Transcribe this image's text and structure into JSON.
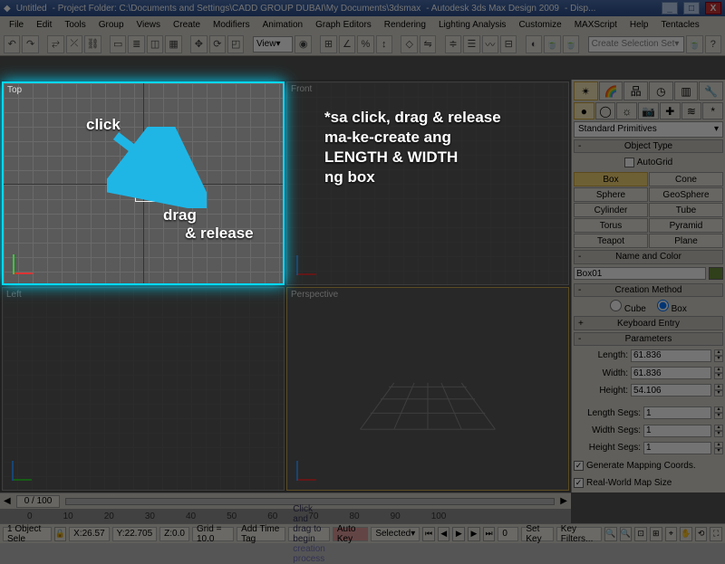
{
  "title": {
    "doc": "Untitled",
    "folder": "- Project Folder: C:\\Documents and Settings\\CADD GROUP DUBAI\\My Documents\\3dsmax",
    "app": "- Autodesk 3ds Max Design 2009",
    "extra": "- Disp..."
  },
  "menu": [
    "File",
    "Edit",
    "Tools",
    "Group",
    "Views",
    "Create",
    "Modifiers",
    "Animation",
    "Graph Editors",
    "Rendering",
    "Lighting Analysis",
    "Customize",
    "MAXScript",
    "Help",
    "Tentacles"
  ],
  "toolbar2": {
    "view_label": "View",
    "selset_placeholder": "Create Selection Set"
  },
  "viewports": {
    "top": "Top",
    "front": "Front",
    "left": "Left",
    "persp": "Perspective"
  },
  "annotation": {
    "click": "click",
    "drag": "drag",
    "release": "& release",
    "note1": "*sa click, drag & release",
    "note2": "ma-ke-create ang",
    "note3": "LENGTH & WIDTH",
    "note4": "ng box"
  },
  "panel": {
    "category": "Standard Primitives",
    "hdr_objtype": "Object Type",
    "autogrid": "AutoGrid",
    "objects": [
      "Box",
      "Cone",
      "Sphere",
      "GeoSphere",
      "Cylinder",
      "Tube",
      "Torus",
      "Pyramid",
      "Teapot",
      "Plane"
    ],
    "active_object": "Box",
    "hdr_name": "Name and Color",
    "obj_name": "Box01",
    "hdr_method": "Creation Method",
    "m_cube": "Cube",
    "m_box": "Box",
    "hdr_kbd": "Keyboard Entry",
    "hdr_params": "Parameters",
    "p_length_l": "Length:",
    "p_length_v": "61.836",
    "p_width_l": "Width:",
    "p_width_v": "61.836",
    "p_height_l": "Height:",
    "p_height_v": "54.106",
    "p_lseg_l": "Length Segs:",
    "p_lseg_v": "1",
    "p_wseg_l": "Width Segs:",
    "p_wseg_v": "1",
    "p_hseg_l": "Height Segs:",
    "p_hseg_v": "1",
    "gen_map": "Generate Mapping Coords.",
    "rw_map": "Real-World Map Size"
  },
  "time": {
    "pos": "0 / 100",
    "ticks": [
      "0",
      "10",
      "20",
      "30",
      "40",
      "50",
      "60",
      "70",
      "80",
      "90",
      "100"
    ]
  },
  "status": {
    "sel": "1 Object Sele",
    "xl": "X:",
    "xv": "26.57",
    "yl": "Y:",
    "yv": "22.705",
    "zl": "Z:",
    "zv": "0.0",
    "grid": "Grid = 10.0",
    "addtag": "Add Time Tag",
    "prompt": "Click and drag to begin creation process",
    "autokey": "Auto Key",
    "setkey": "Set Key",
    "selected": "Selected",
    "keyfilters": "Key Filters...",
    "frame": "0"
  }
}
